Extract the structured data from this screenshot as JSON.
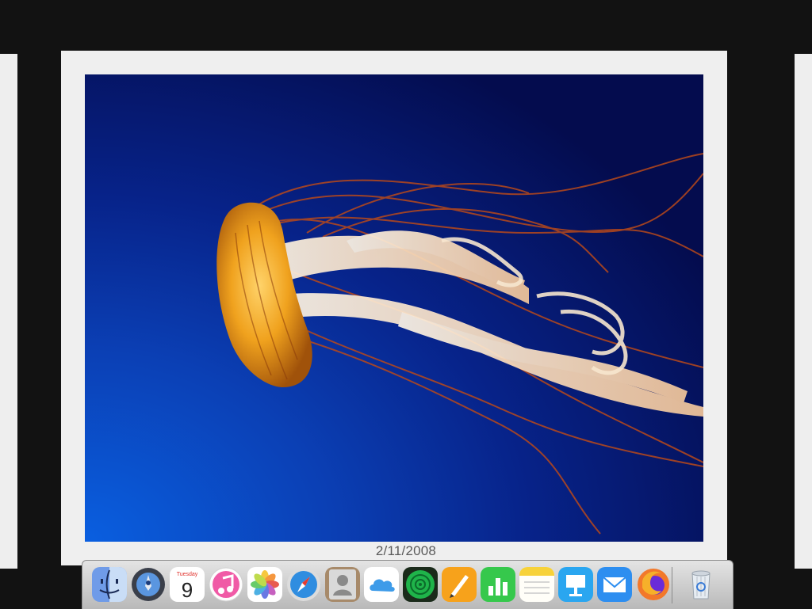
{
  "photo": {
    "date_caption": "2/11/2008"
  },
  "calendar": {
    "weekday": "Tuesday",
    "day": "9"
  },
  "dock": {
    "apps": [
      "Finder",
      "Launchpad",
      "Calendar",
      "iTunes",
      "Photos",
      "Safari",
      "Contacts",
      "iCloud Drive",
      "Find My iPhone",
      "Pages",
      "Numbers",
      "Notes",
      "Keynote",
      "Mail",
      "Firefox"
    ],
    "trash": "Trash"
  }
}
